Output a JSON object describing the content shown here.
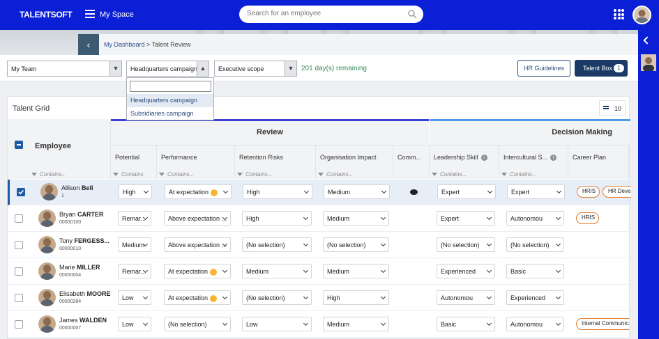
{
  "topbar": {
    "brand": "TALENTSOFT",
    "myspace": "My Space",
    "search_placeholder": "Search for an employee"
  },
  "breadcrumb": {
    "dashboard": "My Dashboard",
    "sep": ">",
    "current": "Talent Review"
  },
  "toolbar": {
    "team": "My Team",
    "campaign": "Headquarters campaign",
    "scope": "Executive scope",
    "remaining": "201 day(s) remaining",
    "hr_guidelines": "HR Guidelines",
    "talent_box": "Talent Box",
    "talent_box_count": "1"
  },
  "dropdown": {
    "options": [
      "Headquarters campaign",
      "Subsidiaries campaign"
    ]
  },
  "grid": {
    "title": "Talent Grid",
    "page_size": "10",
    "employee_label": "Employee",
    "group_review": "Review",
    "group_decision": "Decision Making",
    "columns": [
      "Potential",
      "Performance",
      "Retention Risks",
      "Organisation Impact",
      "Comm...",
      "Leadership Skill",
      "Intercultural S...",
      "Career Plan"
    ],
    "filter_placeholder": "Contains...",
    "filter_short": "Contains",
    "rows": [
      {
        "first": "Allison",
        "last": "Bell",
        "id": "1",
        "potential": "High",
        "performance": "At expectation",
        "retention": "High",
        "impact": "Medium",
        "leadership": "Expert",
        "intercultural": "Expert",
        "tags": [
          "HRIS",
          "HR Develo"
        ]
      },
      {
        "first": "Bryan",
        "last": "CARTER",
        "id": "00000100",
        "potential": "Remar...",
        "performance": "Above expectation ...",
        "retention": "High",
        "impact": "Medium",
        "leadership": "Expert",
        "intercultural": "Autonomou",
        "tags": [
          "HRIS"
        ]
      },
      {
        "first": "Tony",
        "last": "FERGESS...",
        "id": "00000010",
        "potential": "Medium",
        "performance": "Above expectation ...",
        "retention": "(No selection)",
        "impact": "(No selection)",
        "leadership": "(No selection)",
        "intercultural": "(No selection)",
        "tags": []
      },
      {
        "first": "Marie",
        "last": "MILLER",
        "id": "00000004",
        "potential": "Remar...",
        "performance": "At expectation",
        "retention": "Medium",
        "impact": "Medium",
        "leadership": "Experienced",
        "intercultural": "Basic",
        "tags": []
      },
      {
        "first": "Elisabeth",
        "last": "MOORE",
        "id": "00000284",
        "potential": "Low",
        "performance": "At expectation",
        "retention": "(No selection)",
        "impact": "High",
        "leadership": "Autonomou",
        "intercultural": "Experienced",
        "tags": []
      },
      {
        "first": "James",
        "last": "WALDEN",
        "id": "00000007",
        "potential": "Low",
        "performance": "(No selection)",
        "retention": "Low",
        "impact": "Medium",
        "leadership": "Basic",
        "intercultural": "Autonomou",
        "tags": [
          "Internal Communica"
        ]
      }
    ]
  },
  "colors": {
    "brand": "#0a1fd6",
    "accent": "#1f5aa5",
    "tag": "#e07b2c",
    "review_line": "#3b3fd6",
    "decision_line": "#4a9ce8"
  }
}
